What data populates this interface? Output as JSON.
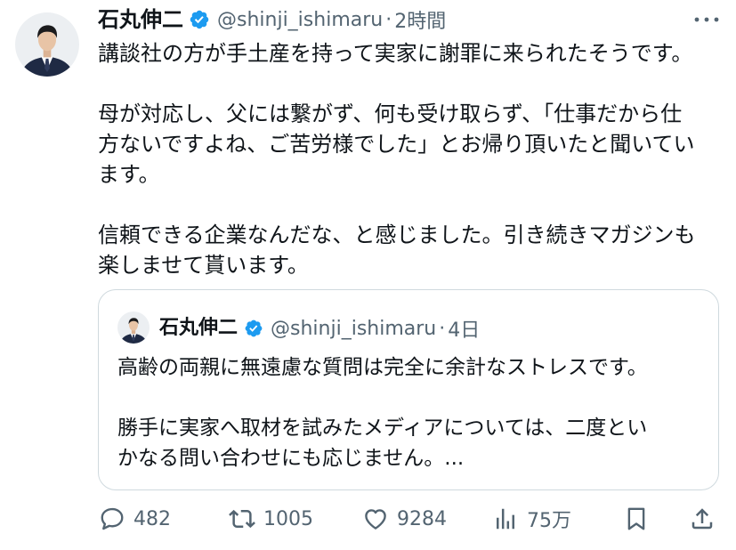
{
  "tweet": {
    "author": {
      "name": "石丸伸二",
      "handle": "@shinji_ishimaru",
      "verified": true,
      "avatar": "avatar-photo"
    },
    "separator": "·",
    "time": "2時間",
    "more_icon": "more-icon",
    "paragraphs": [
      [
        "講談社の方が手土産を持って実家に謝罪に来られたそうです。"
      ],
      [
        "母が対応し、父には繋がず、何も受け取らず、「仕事だから仕",
        "方ないですよね、ご苦労様でした」とお帰り頂いたと聞いてい",
        "ます。"
      ],
      [
        "信頼できる企業なんだな、と感じました。引き続きマガジンも",
        "楽しませて貰います。"
      ]
    ],
    "quote": {
      "author": {
        "name": "石丸伸二",
        "handle": "@shinji_ishimaru",
        "verified": true,
        "avatar": "avatar-photo"
      },
      "time": "4日",
      "paragraphs": [
        [
          "高齢の両親に無遠慮な質問は完全に余計なストレスです。"
        ],
        [
          "勝手に実家へ取材を試みたメディアについては、二度とい",
          "かなる問い合わせにも応じません。..."
        ]
      ]
    },
    "actions": {
      "reply": {
        "icon": "reply-icon",
        "count": "482"
      },
      "retweet": {
        "icon": "retweet-icon",
        "count": "1005"
      },
      "like": {
        "icon": "heart-icon",
        "count": "9284"
      },
      "views": {
        "icon": "views-icon",
        "count": "75万"
      },
      "bookmark": {
        "icon": "bookmark-icon"
      },
      "share": {
        "icon": "share-icon"
      }
    }
  },
  "colors": {
    "text": "#0f1419",
    "secondary": "#536471",
    "verified": "#1d9bf0",
    "border": "#cfd9de"
  }
}
